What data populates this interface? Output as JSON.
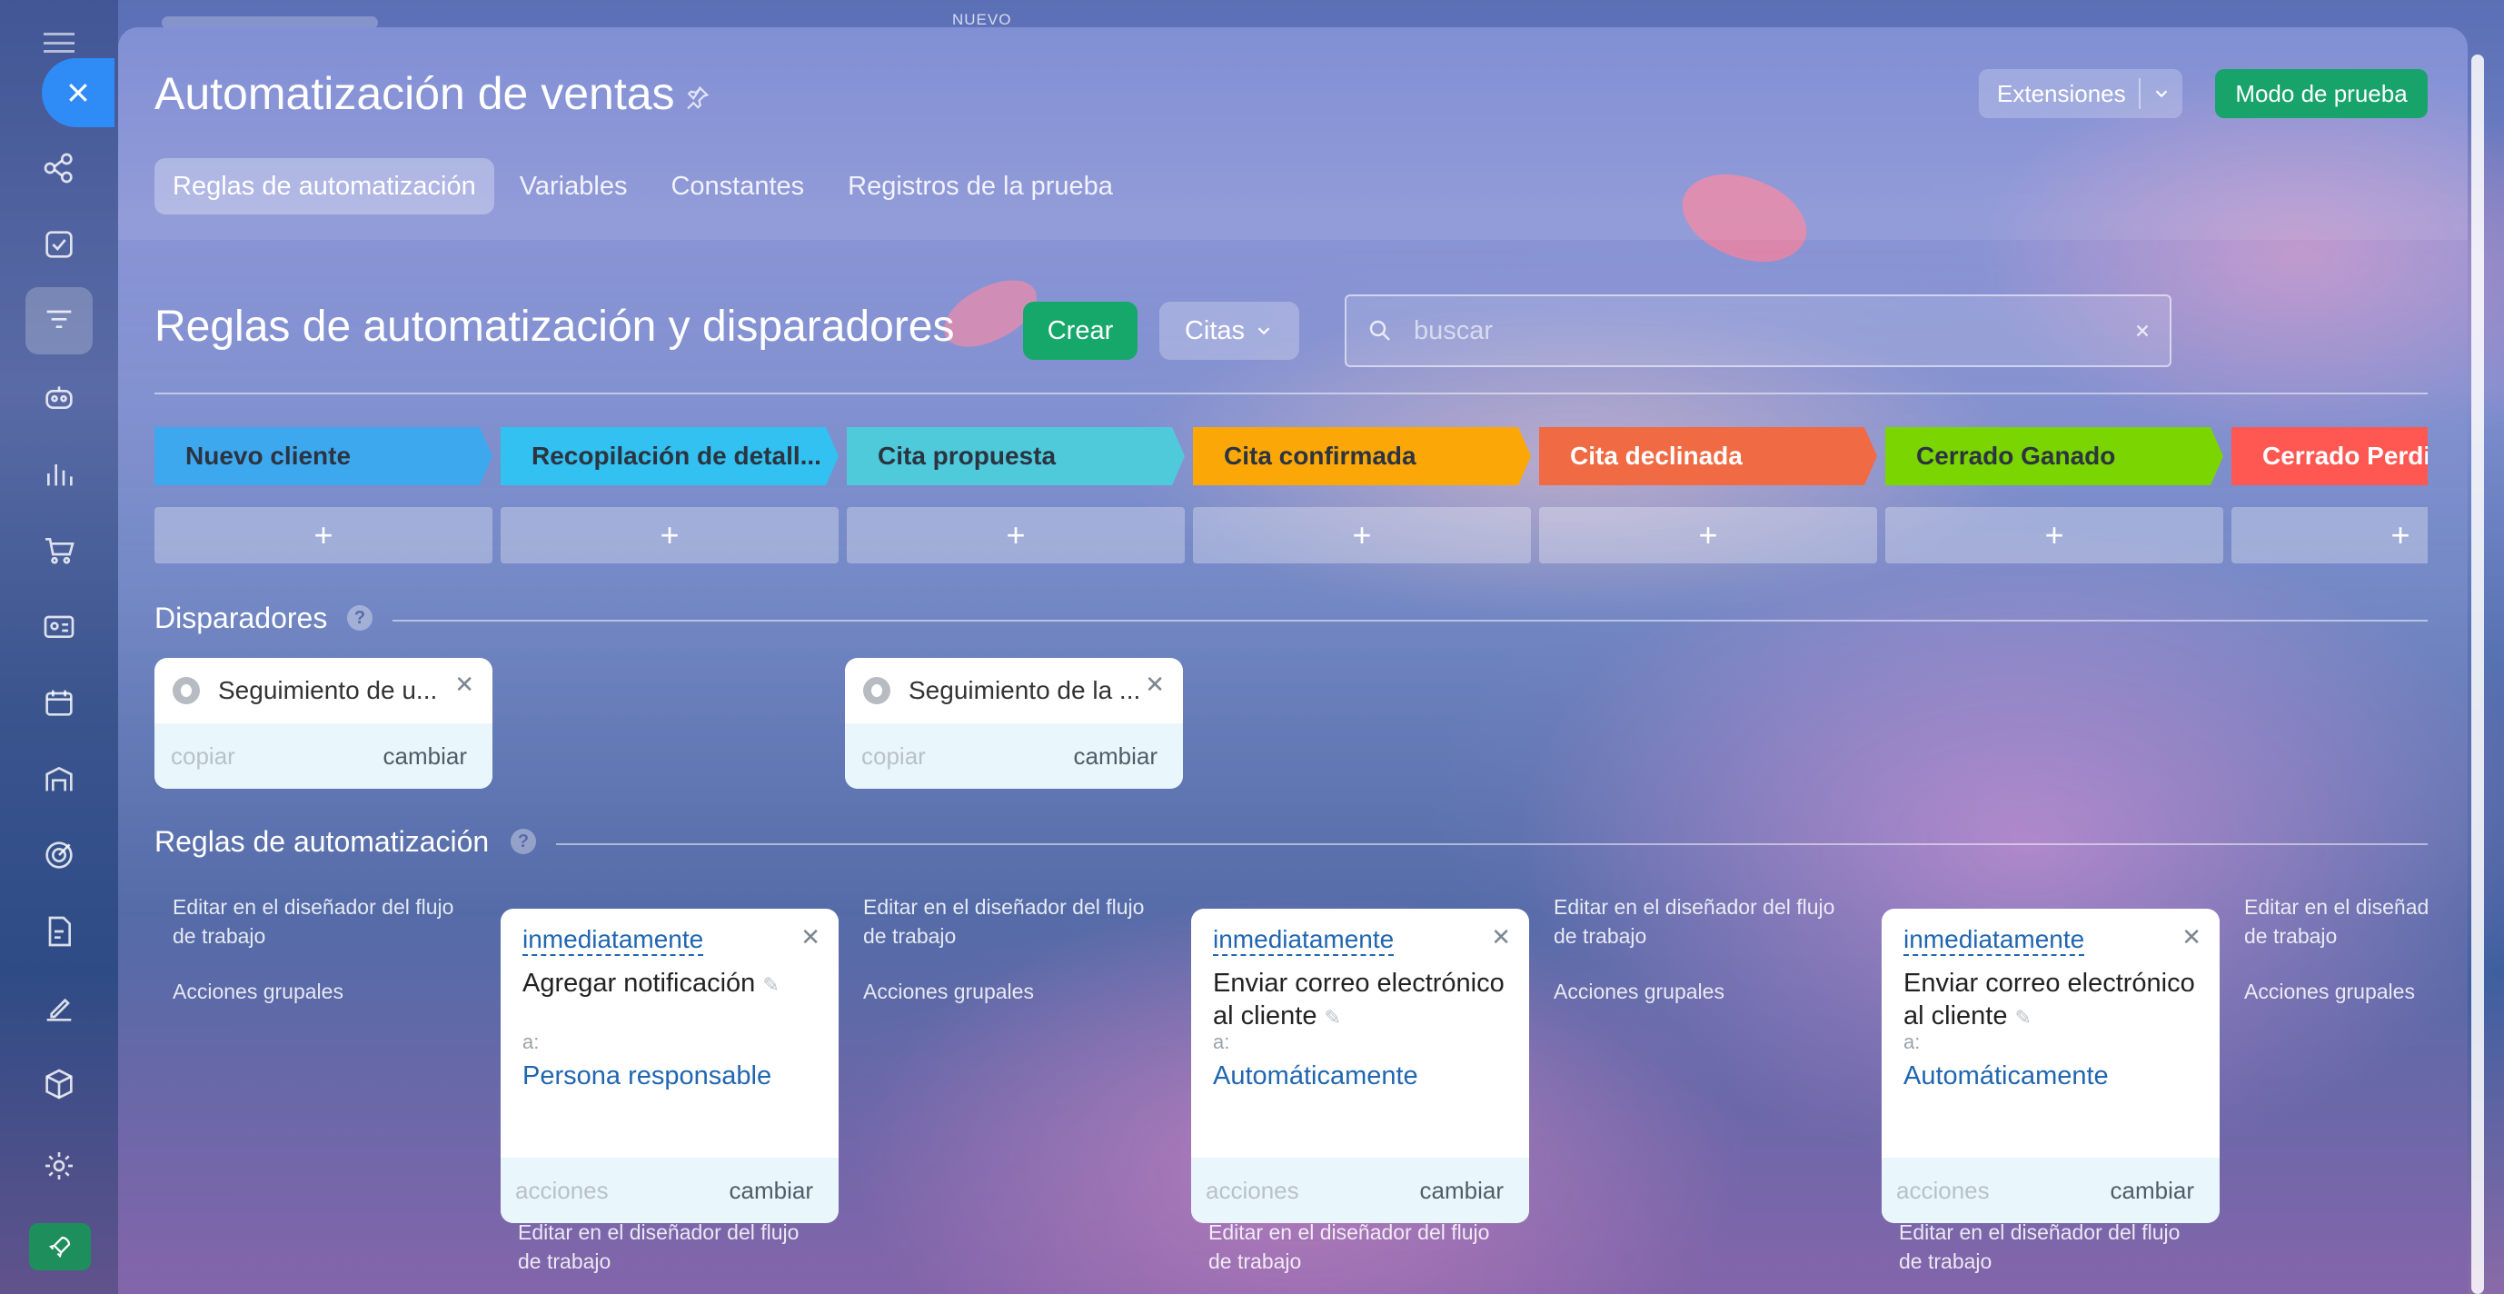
{
  "topbar": {
    "nuevo_label": "NUEVO"
  },
  "header": {
    "title": "Automatización de ventas",
    "extensions_label": "Extensiones",
    "test_mode_label": "Modo de prueba"
  },
  "tabs": [
    {
      "label": "Reglas de automatización",
      "active": true
    },
    {
      "label": "Variables",
      "active": false
    },
    {
      "label": "Constantes",
      "active": false
    },
    {
      "label": "Registros de la prueba",
      "active": false
    }
  ],
  "toolbar": {
    "section_title": "Reglas de automatización y disparadores",
    "create_label": "Crear",
    "pipeline_label": "Citas",
    "search_placeholder": "buscar",
    "search_value": ""
  },
  "stages": [
    {
      "label": "Nuevo cliente",
      "color": "#3ea8ef"
    },
    {
      "label": "Recopilación de detall...",
      "color": "#32c1f0"
    },
    {
      "label": "Cita propuesta",
      "color": "#4fcadb"
    },
    {
      "label": "Cita confirmada",
      "color": "#fba708"
    },
    {
      "label": "Cita declinada",
      "color": "#f06a44"
    },
    {
      "label": "Cerrado Ganado",
      "color": "#7bd500"
    },
    {
      "label": "Cerrado Perdido",
      "color": "#ff5752"
    }
  ],
  "add_symbol": "+",
  "triggers": {
    "title": "Disparadores",
    "help": "?",
    "cards": [
      {
        "title": "Seguimiento de u...",
        "copy_label": "copiar",
        "change_label": "cambiar"
      },
      {
        "title": "Seguimiento de la ...",
        "copy_label": "copiar",
        "change_label": "cambiar"
      }
    ]
  },
  "rules": {
    "title": "Reglas de automatización",
    "help": "?",
    "edit_label": "Editar en el diseñador del flujo de trabajo",
    "group_label": "Acciones grupales",
    "cards": [
      {
        "when": "inmediatamente",
        "name": "Agregar notificación",
        "to_label": "a:",
        "to_value": "Persona responsable",
        "actions_label": "acciones",
        "change_label": "cambiar"
      },
      {
        "when": "inmediatamente",
        "name": "Enviar correo electrónico al cliente",
        "to_label": "a:",
        "to_value": "Automáticamente",
        "actions_label": "acciones",
        "change_label": "cambiar"
      },
      {
        "when": "inmediatamente",
        "name": "Enviar correo electrónico al cliente",
        "to_label": "a:",
        "to_value": "Automáticamente",
        "actions_label": "acciones",
        "change_label": "cambiar"
      }
    ]
  }
}
